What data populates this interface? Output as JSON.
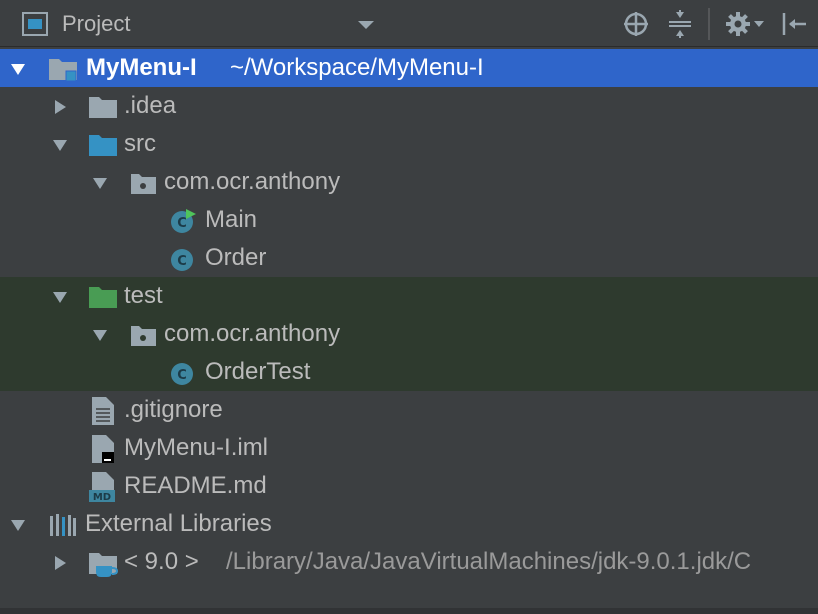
{
  "header": {
    "title": "Project",
    "icons": [
      "project-view-icon",
      "dropdown-arrow-icon",
      "locate-icon",
      "collapse-all-icon",
      "settings-gear-icon",
      "hide-panel-icon"
    ]
  },
  "tree": {
    "root": {
      "name": "MyMenu-I",
      "path": "~/Workspace/MyMenu-I"
    },
    "idea": ".idea",
    "src": "src",
    "src_package": "com.ocr.anthony",
    "main": "Main",
    "order": "Order",
    "test": "test",
    "test_package": "com.ocr.anthony",
    "order_test": "OrderTest",
    "gitignore": ".gitignore",
    "iml": "MyMenu-I.iml",
    "readme": "README.md",
    "external_libraries": "External Libraries",
    "jdk": {
      "name": "< 9.0 >",
      "path": "/Library/Java/JavaVirtualMachines/jdk-9.0.1.jdk/C"
    }
  },
  "colors": {
    "background": "#3c3f41",
    "selection": "#2f65ca",
    "test_row_bg": "#2e3a2e",
    "folder_blue": "#3592c4",
    "folder_green": "#499c54",
    "folder_gray": "#9aa7b0",
    "class_icon": "#3e86a0"
  }
}
